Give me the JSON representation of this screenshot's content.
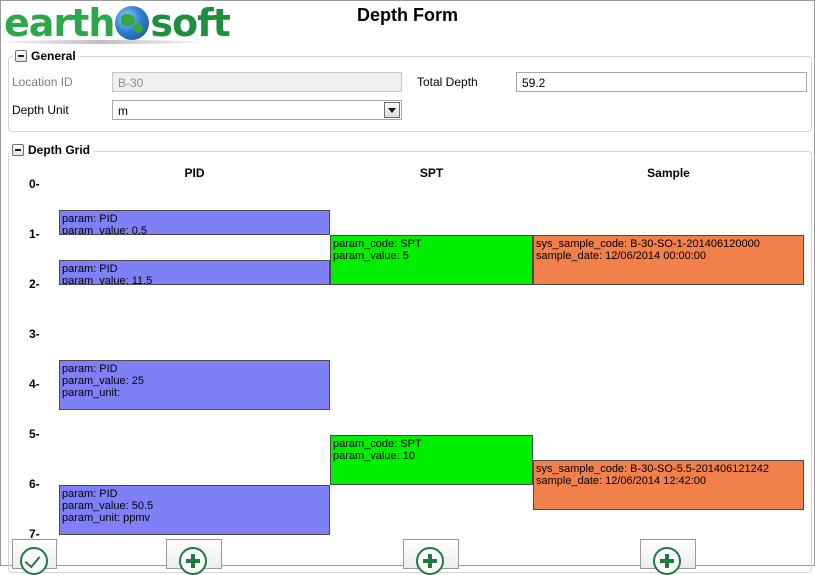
{
  "brand": {
    "logo_text_earth": "earth",
    "logo_text_soft": "soft"
  },
  "form": {
    "title": "Depth Form"
  },
  "general": {
    "legend": "General",
    "location_id_label": "Location ID",
    "location_id_value": "B-30",
    "total_depth_label": "Total Depth",
    "total_depth_value": "59.2",
    "depth_unit_label": "Depth Unit",
    "depth_unit_value": "m"
  },
  "depth_grid": {
    "legend": "Depth Grid",
    "columns": [
      "PID",
      "SPT",
      "Sample"
    ],
    "ticks": [
      "0-",
      "1-",
      "2-",
      "3-",
      "4-",
      "5-",
      "6-",
      "7-"
    ],
    "pid_blocks": [
      {
        "lines": [
          "param: PID",
          "param_value: 0.5"
        ]
      },
      {
        "lines": [
          "param: PID",
          "param_value: 11.5"
        ]
      },
      {
        "lines": [
          "param: PID",
          "param_value: 25",
          "param_unit:"
        ]
      },
      {
        "lines": [
          "param: PID",
          "param_value: 50.5",
          "param_unit: ppmv"
        ]
      }
    ],
    "spt_blocks": [
      {
        "lines": [
          "param_code: SPT",
          "param_value: 5"
        ]
      },
      {
        "lines": [
          "param_code: SPT",
          "param_value: 10"
        ]
      }
    ],
    "sample_blocks": [
      {
        "lines": [
          "sys_sample_code: B-30-SO-1-201406120000",
          "sample_date: 12/06/2014 00:00:00"
        ]
      },
      {
        "lines": [
          "sys_sample_code: B-30-SO-5.5-201406121242",
          "sample_date: 12/06/2014 12:42:00"
        ]
      }
    ]
  },
  "colors": {
    "pid": "#7f7ff7",
    "spt": "#00ee00",
    "sample": "#f2804a",
    "accent": "#1f7a3e"
  },
  "icons": {
    "confirm": "check-circle-icon",
    "add": "plus-circle-icon",
    "collapse": "minus-box-icon"
  }
}
